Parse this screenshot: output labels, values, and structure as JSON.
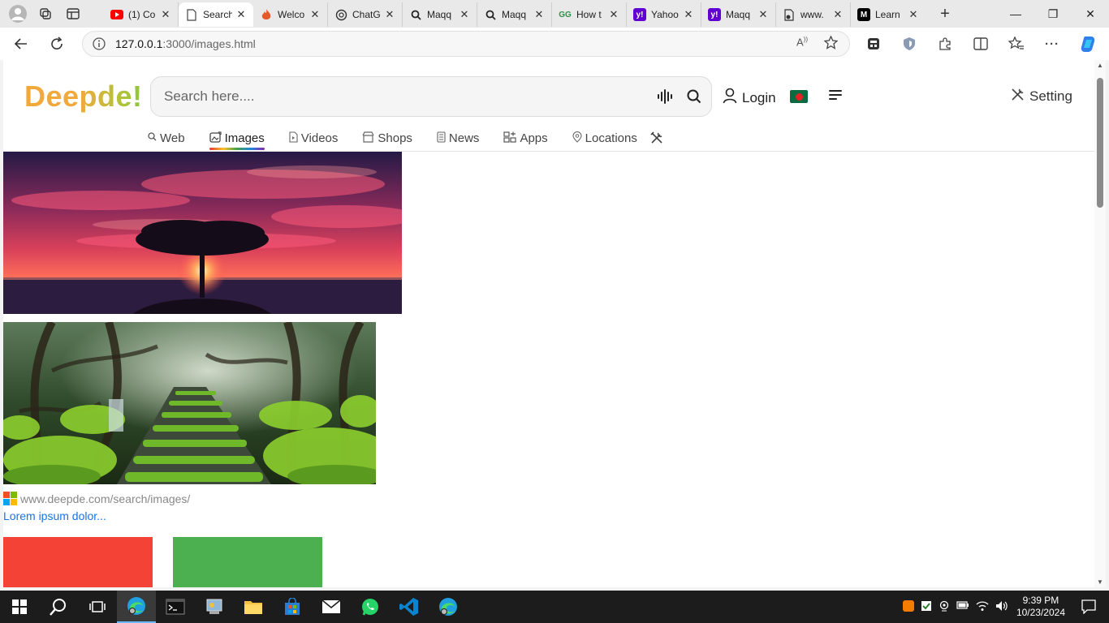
{
  "browser": {
    "tabs": [
      {
        "title": "(1) Co",
        "favicon": "youtube-icon",
        "color": "#ff0000",
        "active": false
      },
      {
        "title": "Search",
        "favicon": "page-icon",
        "color": "#555555",
        "active": true
      },
      {
        "title": "Welco",
        "favicon": "fire-icon",
        "color": "#e8572a",
        "active": false
      },
      {
        "title": "ChatG",
        "favicon": "chatgpt-icon",
        "color": "#333333",
        "active": false
      },
      {
        "title": "Maqq",
        "favicon": "search-icon",
        "color": "#333333",
        "active": false
      },
      {
        "title": "Maqq",
        "favicon": "search-icon",
        "color": "#333333",
        "active": false
      },
      {
        "title": "How t",
        "favicon": "gfg-icon",
        "color": "#2f8d46",
        "active": false
      },
      {
        "title": "Yahoo",
        "favicon": "yahoo-icon",
        "color": "#6001d2",
        "active": false
      },
      {
        "title": "Maqq",
        "favicon": "yahoo-icon",
        "color": "#6001d2",
        "active": false
      },
      {
        "title": "www.",
        "favicon": "page-lock-icon",
        "color": "#333333",
        "active": false
      },
      {
        "title": "Learn",
        "favicon": "medium-icon",
        "color": "#000000",
        "active": false
      }
    ],
    "url_host": "127.0.0.1",
    "url_path": ":3000/images.html"
  },
  "site": {
    "logo": "Deepde!",
    "search_placeholder": "Search here....",
    "login_label": "Login",
    "setting_label": "Setting",
    "nav": [
      {
        "label": "Web",
        "icon": "search-icon"
      },
      {
        "label": "Images",
        "icon": "image-icon",
        "active": true
      },
      {
        "label": "Videos",
        "icon": "video-file-icon"
      },
      {
        "label": "Shops",
        "icon": "shop-icon"
      },
      {
        "label": "News",
        "icon": "news-icon"
      },
      {
        "label": "Apps",
        "icon": "apps-icon"
      },
      {
        "label": "Locations",
        "icon": "location-icon"
      }
    ]
  },
  "results": {
    "source_url": "www.deepde.com/search/images/",
    "title": "Lorem ipsum dolor..."
  },
  "taskbar": {
    "time": "9:39 PM",
    "date": "10/23/2024"
  },
  "colors": {
    "accent_blue": "#1a73e8",
    "block_red": "#f44336",
    "block_green": "#4caf50"
  }
}
